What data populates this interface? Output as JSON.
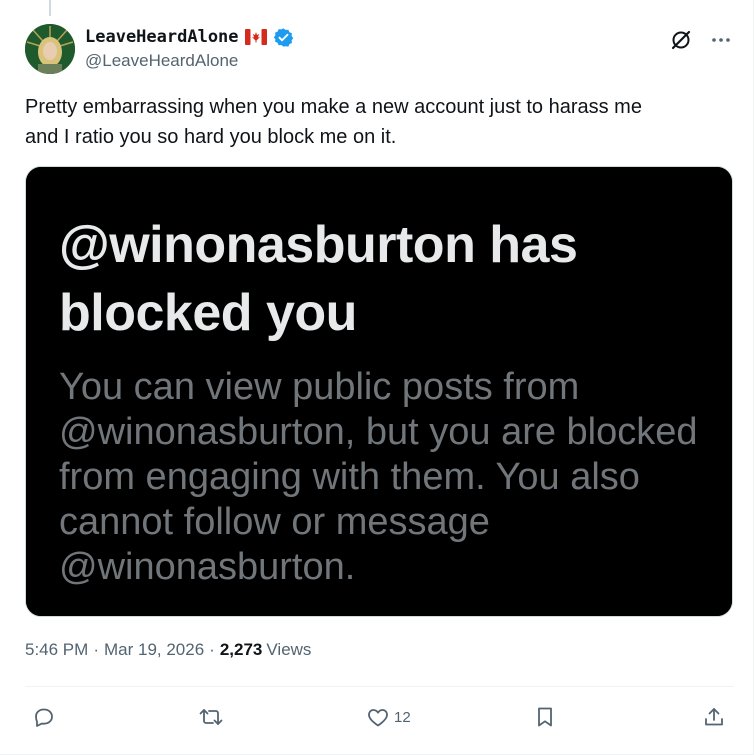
{
  "author": {
    "display_name": "LeaveHeardAlone",
    "handle": "@LeaveHeardAlone",
    "flag": "canada-flag",
    "verified": true,
    "verified_color": "#1d9bf0"
  },
  "tweet": {
    "text": "Pretty embarrassing when you make a new account just to harass me\nand I ratio you so hard you block me on it."
  },
  "media": {
    "title": "@winonasburton has blocked you",
    "body": "You can view public posts from @winonasburton, but you are blocked from engaging with them. You also cannot follow or message @winonasburton.",
    "background": "#000000"
  },
  "meta": {
    "time": "5:46 PM",
    "separator": "·",
    "date": "Mar 19, 2026",
    "views_count": "2,273",
    "views_label": "Views"
  },
  "actions": {
    "reply_icon": "reply-icon",
    "retweet_icon": "retweet-icon",
    "like_icon": "heart-icon",
    "like_count": "12",
    "bookmark_icon": "bookmark-icon",
    "share_icon": "share-icon"
  },
  "header_icons": {
    "grok": "grok-icon",
    "more": "more-icon"
  },
  "colors": {
    "text_primary": "#0f1419",
    "text_secondary": "#536471",
    "accent": "#1d9bf0"
  }
}
